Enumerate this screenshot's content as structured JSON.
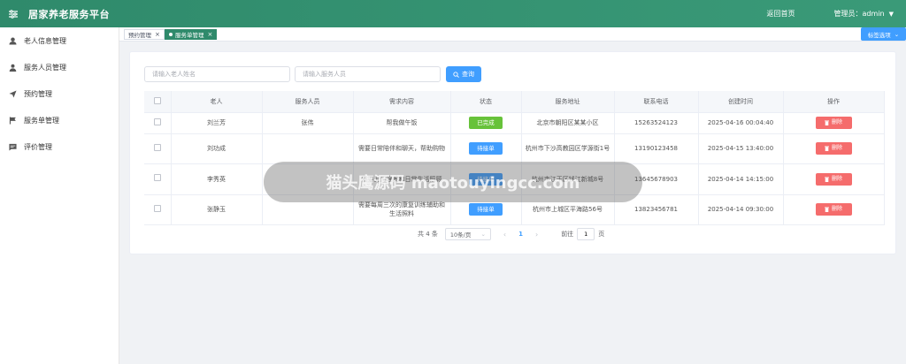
{
  "header": {
    "title": "居家养老服务平台",
    "home_link": "返回首页",
    "user": "管理员：admin"
  },
  "sidebar": {
    "items": [
      {
        "label": "老人信息管理",
        "icon": "user-icon"
      },
      {
        "label": "服务人员管理",
        "icon": "user-filled-icon"
      },
      {
        "label": "预约管理",
        "icon": "send-icon"
      },
      {
        "label": "服务单管理",
        "icon": "flag-icon"
      },
      {
        "label": "评价管理",
        "icon": "message-icon"
      }
    ]
  },
  "tabs": [
    {
      "label": "预约管理",
      "active": false
    },
    {
      "label": "服务单管理",
      "active": true
    }
  ],
  "tag_options_label": "标签选项",
  "search": {
    "elder_placeholder": "请输入老人姓名",
    "staff_placeholder": "请输入服务人员",
    "query_label": "查询"
  },
  "table": {
    "headers": [
      "老人",
      "服务人员",
      "需求内容",
      "状态",
      "服务地址",
      "联系电话",
      "创建时间",
      "操作"
    ],
    "rows": [
      {
        "elder": "刘兰芳",
        "staff": "张伟",
        "demand": "帮我做午饭",
        "status": "已完成",
        "address": "北京市朝阳区某某小区",
        "phone": "15263524123",
        "created": "2025-04-16 00:04:40",
        "action": "删除"
      },
      {
        "elder": "刘功成",
        "staff": "",
        "demand": "需要日常陪伴和聊天，帮助购物",
        "status": "待接单",
        "address": "杭州市下沙高教园区学源街1号",
        "phone": "13190123458",
        "created": "2025-04-15 13:40:00",
        "action": "删除"
      },
      {
        "elder": "李秀英",
        "staff": "",
        "demand": "需要上门理发和日常生活照顾",
        "status": "待接单",
        "address": "杭州市江干区钱江新城8号",
        "phone": "13645678903",
        "created": "2025-04-14 14:15:00",
        "action": "删除"
      },
      {
        "elder": "张静玉",
        "staff": "",
        "demand": "需要每周三次的康复训练辅助和生活照料",
        "status": "待接单",
        "address": "杭州市上城区平海路56号",
        "phone": "13823456781",
        "created": "2025-04-14 09:30:00",
        "action": "删除"
      }
    ]
  },
  "pagination": {
    "total": "共 4 条",
    "page_size": "10条/页",
    "current_page": "1",
    "goto_label": "前往",
    "goto_value": "1",
    "page_unit": "页"
  },
  "watermark": "猫头鹰源码 maotouyingcc.com",
  "colors": {
    "header_bg": "#2f8a6b",
    "primary": "#409eff",
    "success": "#67c23a",
    "danger": "#f56c6c"
  }
}
